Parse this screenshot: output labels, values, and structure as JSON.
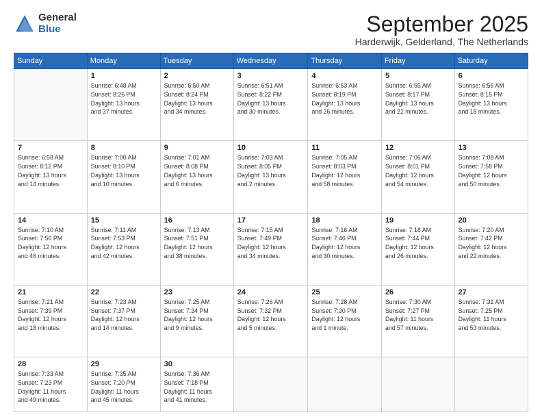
{
  "logo": {
    "general": "General",
    "blue": "Blue"
  },
  "header": {
    "month": "September 2025",
    "location": "Harderwijk, Gelderland, The Netherlands"
  },
  "weekdays": [
    "Sunday",
    "Monday",
    "Tuesday",
    "Wednesday",
    "Thursday",
    "Friday",
    "Saturday"
  ],
  "weeks": [
    [
      {
        "day": "",
        "info": ""
      },
      {
        "day": "1",
        "info": "Sunrise: 6:48 AM\nSunset: 8:26 PM\nDaylight: 13 hours\nand 37 minutes."
      },
      {
        "day": "2",
        "info": "Sunrise: 6:50 AM\nSunset: 8:24 PM\nDaylight: 13 hours\nand 34 minutes."
      },
      {
        "day": "3",
        "info": "Sunrise: 6:51 AM\nSunset: 8:22 PM\nDaylight: 13 hours\nand 30 minutes."
      },
      {
        "day": "4",
        "info": "Sunrise: 6:53 AM\nSunset: 8:19 PM\nDaylight: 13 hours\nand 26 minutes."
      },
      {
        "day": "5",
        "info": "Sunrise: 6:55 AM\nSunset: 8:17 PM\nDaylight: 13 hours\nand 22 minutes."
      },
      {
        "day": "6",
        "info": "Sunrise: 6:56 AM\nSunset: 8:15 PM\nDaylight: 13 hours\nand 18 minutes."
      }
    ],
    [
      {
        "day": "7",
        "info": "Sunrise: 6:58 AM\nSunset: 8:12 PM\nDaylight: 13 hours\nand 14 minutes."
      },
      {
        "day": "8",
        "info": "Sunrise: 7:00 AM\nSunset: 8:10 PM\nDaylight: 13 hours\nand 10 minutes."
      },
      {
        "day": "9",
        "info": "Sunrise: 7:01 AM\nSunset: 8:08 PM\nDaylight: 13 hours\nand 6 minutes."
      },
      {
        "day": "10",
        "info": "Sunrise: 7:03 AM\nSunset: 8:05 PM\nDaylight: 13 hours\nand 2 minutes."
      },
      {
        "day": "11",
        "info": "Sunrise: 7:05 AM\nSunset: 8:03 PM\nDaylight: 12 hours\nand 58 minutes."
      },
      {
        "day": "12",
        "info": "Sunrise: 7:06 AM\nSunset: 8:01 PM\nDaylight: 12 hours\nand 54 minutes."
      },
      {
        "day": "13",
        "info": "Sunrise: 7:08 AM\nSunset: 7:58 PM\nDaylight: 12 hours\nand 50 minutes."
      }
    ],
    [
      {
        "day": "14",
        "info": "Sunrise: 7:10 AM\nSunset: 7:56 PM\nDaylight: 12 hours\nand 46 minutes."
      },
      {
        "day": "15",
        "info": "Sunrise: 7:11 AM\nSunset: 7:53 PM\nDaylight: 12 hours\nand 42 minutes."
      },
      {
        "day": "16",
        "info": "Sunrise: 7:13 AM\nSunset: 7:51 PM\nDaylight: 12 hours\nand 38 minutes."
      },
      {
        "day": "17",
        "info": "Sunrise: 7:15 AM\nSunset: 7:49 PM\nDaylight: 12 hours\nand 34 minutes."
      },
      {
        "day": "18",
        "info": "Sunrise: 7:16 AM\nSunset: 7:46 PM\nDaylight: 12 hours\nand 30 minutes."
      },
      {
        "day": "19",
        "info": "Sunrise: 7:18 AM\nSunset: 7:44 PM\nDaylight: 12 hours\nand 26 minutes."
      },
      {
        "day": "20",
        "info": "Sunrise: 7:20 AM\nSunset: 7:42 PM\nDaylight: 12 hours\nand 22 minutes."
      }
    ],
    [
      {
        "day": "21",
        "info": "Sunrise: 7:21 AM\nSunset: 7:39 PM\nDaylight: 12 hours\nand 18 minutes."
      },
      {
        "day": "22",
        "info": "Sunrise: 7:23 AM\nSunset: 7:37 PM\nDaylight: 12 hours\nand 14 minutes."
      },
      {
        "day": "23",
        "info": "Sunrise: 7:25 AM\nSunset: 7:34 PM\nDaylight: 12 hours\nand 9 minutes."
      },
      {
        "day": "24",
        "info": "Sunrise: 7:26 AM\nSunset: 7:32 PM\nDaylight: 12 hours\nand 5 minutes."
      },
      {
        "day": "25",
        "info": "Sunrise: 7:28 AM\nSunset: 7:30 PM\nDaylight: 12 hours\nand 1 minute."
      },
      {
        "day": "26",
        "info": "Sunrise: 7:30 AM\nSunset: 7:27 PM\nDaylight: 11 hours\nand 57 minutes."
      },
      {
        "day": "27",
        "info": "Sunrise: 7:31 AM\nSunset: 7:25 PM\nDaylight: 11 hours\nand 53 minutes."
      }
    ],
    [
      {
        "day": "28",
        "info": "Sunrise: 7:33 AM\nSunset: 7:23 PM\nDaylight: 11 hours\nand 49 minutes."
      },
      {
        "day": "29",
        "info": "Sunrise: 7:35 AM\nSunset: 7:20 PM\nDaylight: 11 hours\nand 45 minutes."
      },
      {
        "day": "30",
        "info": "Sunrise: 7:36 AM\nSunset: 7:18 PM\nDaylight: 11 hours\nand 41 minutes."
      },
      {
        "day": "",
        "info": ""
      },
      {
        "day": "",
        "info": ""
      },
      {
        "day": "",
        "info": ""
      },
      {
        "day": "",
        "info": ""
      }
    ]
  ]
}
